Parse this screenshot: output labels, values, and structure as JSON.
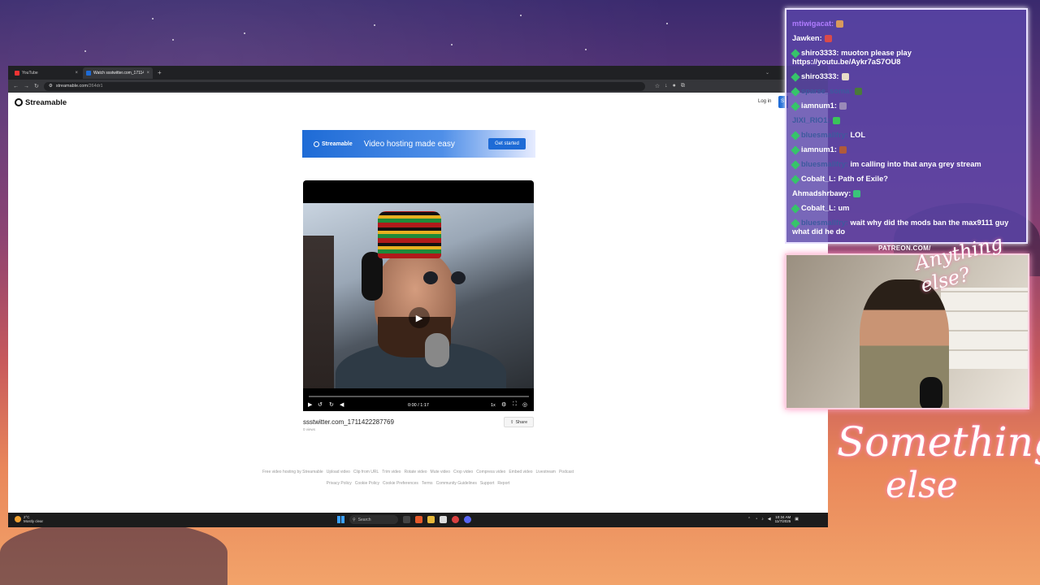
{
  "colors": {
    "streamable_blue": "#1e6bd6",
    "chat_bg": "#5a46aa",
    "chat_badge": "#36c46a",
    "browser_dark": "#202124"
  },
  "browser": {
    "tabs": [
      {
        "label": "YouTube",
        "icon": "youtube-icon"
      },
      {
        "label": "Watch ssstwitter.com_17114222",
        "icon": "streamable-icon"
      }
    ],
    "url": {
      "host": "streamable.com",
      "path": "/264dr1"
    }
  },
  "streamable": {
    "logo_text": "Streamable",
    "login_label": "Log in",
    "signup_label": "S",
    "banner": {
      "logo_text": "Streamable",
      "tagline": "Video hosting made easy",
      "cta": "Get started"
    },
    "player": {
      "time": "0:00 / 1:17",
      "speed": "1x",
      "progress": 0.0
    },
    "video_title": "ssstwitter.com_1711422287769",
    "views": "0 views",
    "share_label": "Share",
    "footer_row1": [
      "Free video hosting by Streamable",
      "Upload video",
      "Clip from URL",
      "Trim video",
      "Rotate video",
      "Mute video",
      "Crop video",
      "Compress video",
      "Embed video",
      "Livestream",
      "Podcast"
    ],
    "footer_row2": [
      "Privacy Policy",
      "Cookie Policy",
      "Cookie Preferences",
      "Terms",
      "Community Guidelines",
      "Support",
      "Report"
    ]
  },
  "taskbar": {
    "weather_temp": "2°C",
    "weather_desc": "Mostly clear",
    "search_placeholder": "Search",
    "time": "10:34 AM",
    "date": "11/7/2025"
  },
  "chat": {
    "messages": [
      {
        "user": "mtiwigacat:",
        "text": "",
        "badge": false,
        "user_color": "#b07cff",
        "emote": "#d99a5c"
      },
      {
        "user": "Jawken:",
        "text": "",
        "badge": false,
        "user_color": "#ffffff",
        "emote": "#d94a4a"
      },
      {
        "user": "shiro3333:",
        "text": "muoton please play https://youtu.be/Aykr7aS7OU8",
        "badge": true,
        "user_color": "#ffffff",
        "emote": ""
      },
      {
        "user": "shiro3333:",
        "text": "",
        "badge": true,
        "user_color": "#ffffff",
        "emote": "#e7dcc8"
      },
      {
        "user": "sparse_soma:",
        "text": "",
        "badge": true,
        "user_color": "#3d5a9e",
        "emote": "#4a7a3a"
      },
      {
        "user": "iamnum1:",
        "text": "",
        "badge": true,
        "user_color": "#ffffff",
        "emote": "#9a8ab8"
      },
      {
        "user": "JIXI_RIO1:",
        "text": "",
        "badge": false,
        "user_color": "#3d5a9e",
        "emote": "#3ac45a"
      },
      {
        "user": "bluesmallfry:",
        "text": "LOL",
        "badge": true,
        "user_color": "#3d5a9e",
        "emote": ""
      },
      {
        "user": "iamnum1:",
        "text": "",
        "badge": true,
        "user_color": "#ffffff",
        "emote": "#b05a3a"
      },
      {
        "user": "bluesmallfry:",
        "text": "im calling into that anya grey stream",
        "badge": true,
        "user_color": "#3d5a9e",
        "emote": ""
      },
      {
        "user": "Cobalt_L:",
        "text": "Path of Exile?",
        "badge": true,
        "user_color": "#ffffff",
        "emote": ""
      },
      {
        "user": "Ahmadshrbawy:",
        "text": "",
        "badge": false,
        "user_color": "#ffffff",
        "emote": "#3ac47a"
      },
      {
        "user": "Cobalt_L:",
        "text": "um",
        "badge": true,
        "user_color": "#ffffff",
        "emote": ""
      },
      {
        "user": "bluesmallfry:",
        "text": "wait why did the mods ban the max9111 guy what did he do",
        "badge": true,
        "user_color": "#3d5a9e",
        "emote": ""
      }
    ]
  },
  "overlay": {
    "patreon": "PATREON.COM/",
    "anything_else": "Anything else?",
    "something_else_1": "Something",
    "something_else_2": "else"
  }
}
